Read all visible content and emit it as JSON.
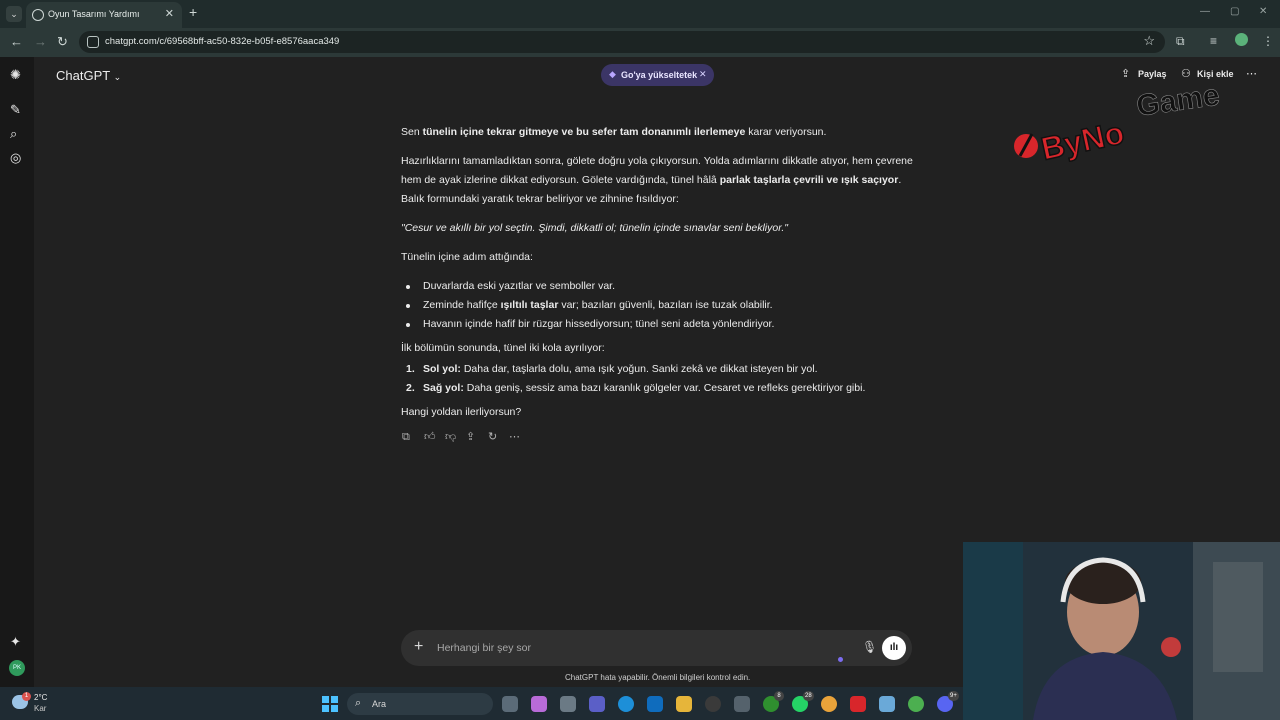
{
  "browser": {
    "tab_title": "Oyun Tasarımı Yardımı",
    "url": "chatgpt.com/c/69568bff-ac50-832e-b05f-e8576aaca349"
  },
  "header": {
    "app_title": "ChatGPT",
    "upgrade_pill": "Go'ya yükseltetek",
    "share_label": "Paylaş",
    "add_person_label": "Kişi ekle"
  },
  "watermark": {
    "text_by": "ByNo",
    "text_game": "Game"
  },
  "message": {
    "p1_pre": "Sen ",
    "p1_bold": "tünelin içine tekrar gitmeye ve bu sefer tam donanımlı ilerlemeye",
    "p1_post": " karar veriyorsun.",
    "p2_line1": "Hazırlıklarını tamamladıktan sonra, gölete doğru yola çıkıyorsun. Yolda adımlarını dikkatle atıyor, hem çevrene",
    "p2_line2_pre": "hem de ayak izlerine dikkat ediyorsun. Gölete vardığında, tünel hâlâ ",
    "p2_line2_bold": "parlak taşlarla çevrili ve ışık saçıyor",
    "p2_line2_post": ".",
    "p2_line3": "Balık formundaki yaratık tekrar beliriyor ve zihnine fısıldıyor:",
    "quote": "\"Cesur ve akıllı bir yol seçtin. Şimdi, dikkatli ol; tünelin içinde sınavlar seni bekliyor.\"",
    "p3": "Tünelin içine adım attığında:",
    "bullet1": "Duvarlarda eski yazıtlar ve semboller var.",
    "bullet2_pre": "Zeminde hafifçe ",
    "bullet2_bold": "ışıltılı taşlar",
    "bullet2_post": " var; bazıları güvenli, bazıları ise tuzak olabilir.",
    "bullet3": "Havanın içinde hafif bir rüzgar hissediyorsun; tünel seni adeta yönlendiriyor.",
    "p4": "İlk bölümün sonunda, tünel iki kola ayrılıyor:",
    "item1_num": "1.",
    "item1_bold": "Sol yol:",
    "item1_text": " Daha dar, taşlarla dolu, ama ışık yoğun. Sanki zekâ ve dikkat isteyen bir yol.",
    "item2_num": "2.",
    "item2_bold": "Sağ yol:",
    "item2_text": " Daha geniş, sessiz ama bazı karanlık gölgeler var. Cesaret ve refleks gerektiriyor gibi.",
    "question": "Hangi yoldan ilerliyorsun?"
  },
  "composer": {
    "placeholder": "Herhangi bir şey sor",
    "disclaimer": "ChatGPT hata yapabilir. Önemli bilgileri kontrol edin."
  },
  "rail": {
    "avatar_initials": "PK"
  },
  "taskbar": {
    "weather_temp": "2°C",
    "weather_cond": "Kar",
    "weather_badge": "1",
    "search_label": "Ara",
    "badge_xbox": "8",
    "badge_whatsapp": "28",
    "badge_discord": "9+"
  },
  "colors": {
    "background": "#212121",
    "upgrade_pill": "#3b3566",
    "accent_purple": "#7c6cf0",
    "watermark_red": "#d8262b"
  }
}
